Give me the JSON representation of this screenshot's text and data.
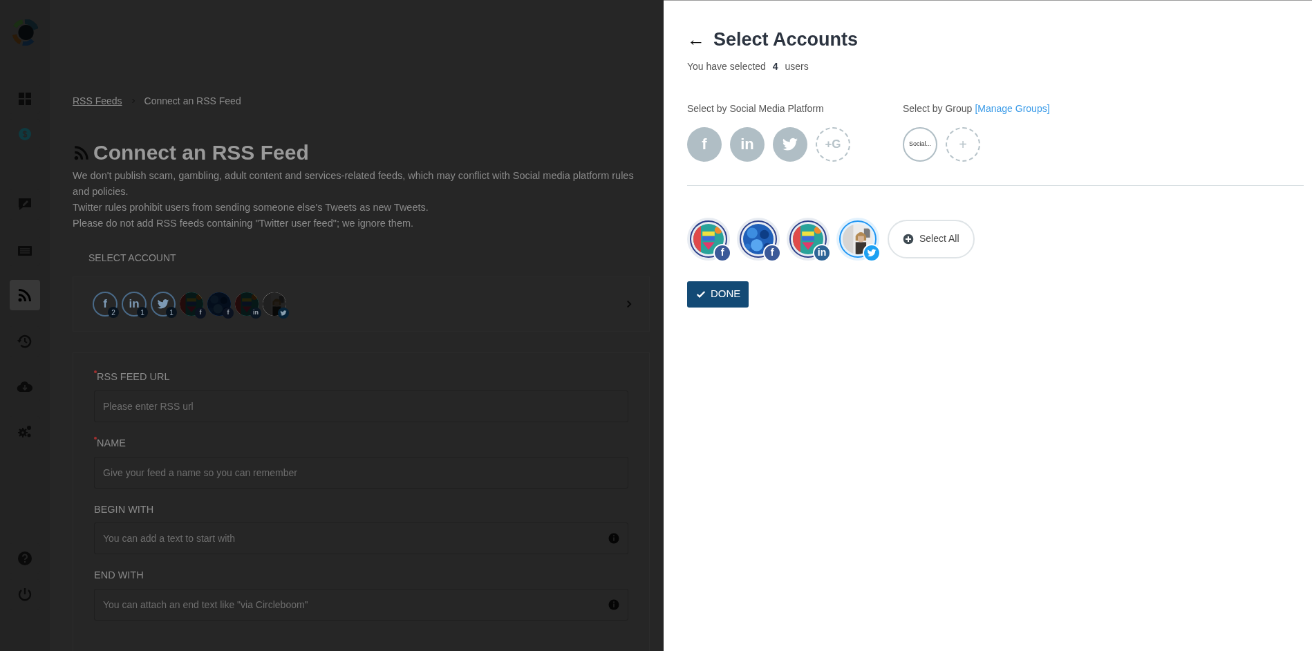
{
  "sidebar": {
    "items": [
      {
        "selected": false
      },
      {
        "selected": false
      },
      {
        "selected": false
      },
      {
        "selected": false
      },
      {
        "selected": true
      },
      {
        "selected": false
      },
      {
        "selected": false
      },
      {
        "selected": false
      },
      {
        "selected": false
      },
      {
        "selected": false
      }
    ]
  },
  "breadcrumb": [
    "RSS Feeds",
    "Connect an RSS Feed"
  ],
  "page_title": "Connect an RSS Feed",
  "description": [
    "We don't publish scam, gambling, adult content and services-related feeds, which may conflict with Social media platform rules and policies.",
    "Twitter rules prohibit users from sending someone else's Tweets as new Tweets.",
    "Please do not add RSS feeds containing \"Twitter user feed\"; we ignore them."
  ],
  "select_account": {
    "label": "SELECT ACCOUNT",
    "platforms": [
      {
        "kind": "facebook",
        "label": "f",
        "count": "2"
      },
      {
        "kind": "linkedin",
        "label": "in",
        "count": "1"
      },
      {
        "kind": "twitter",
        "count": "1"
      }
    ],
    "accounts": [
      {
        "kind": "facebook",
        "badge": "f"
      },
      {
        "kind": "facebook",
        "badge": "f"
      },
      {
        "kind": "linkedin",
        "badge": "in"
      },
      {
        "kind": "twitter"
      }
    ]
  },
  "form": [
    {
      "label": "RSS FEED URL",
      "required": true,
      "placeholder": "Please enter RSS url",
      "info": false
    },
    {
      "label": "NAME",
      "required": true,
      "placeholder": "Give your feed a name so you can remember",
      "info": false
    },
    {
      "label": "BEGIN WITH",
      "required": false,
      "placeholder": "You can add a text to start with",
      "info": true
    },
    {
      "label": "END WITH",
      "required": false,
      "placeholder": "You can attach an end text like \"via Circleboom\"",
      "info": true
    }
  ],
  "panel": {
    "title": "Select Accounts",
    "back": "←",
    "selected_text": "You have selected **4** users",
    "platform_label": "Select by Social Media Platform",
    "platforms": [
      {
        "kind": "facebook",
        "label": "f"
      },
      {
        "kind": "linkedin",
        "label": "in"
      },
      {
        "kind": "twitter"
      },
      {
        "kind": "add",
        "label": "+G"
      }
    ],
    "group_label": "Select by Group",
    "group_link": "[Manage Groups]",
    "groups": [
      {
        "kind": "group",
        "label": "Social..."
      },
      {
        "kind": "add",
        "label": "+"
      }
    ],
    "accounts": [
      {
        "kind": "facebook",
        "badge": "f",
        "selected": true
      },
      {
        "kind": "facebook",
        "badge": "f",
        "selected": true
      },
      {
        "kind": "linkedin",
        "badge": "in",
        "selected": true
      },
      {
        "kind": "twitter",
        "selected": true
      }
    ],
    "select_all": "Select All",
    "done": "DONE"
  }
}
